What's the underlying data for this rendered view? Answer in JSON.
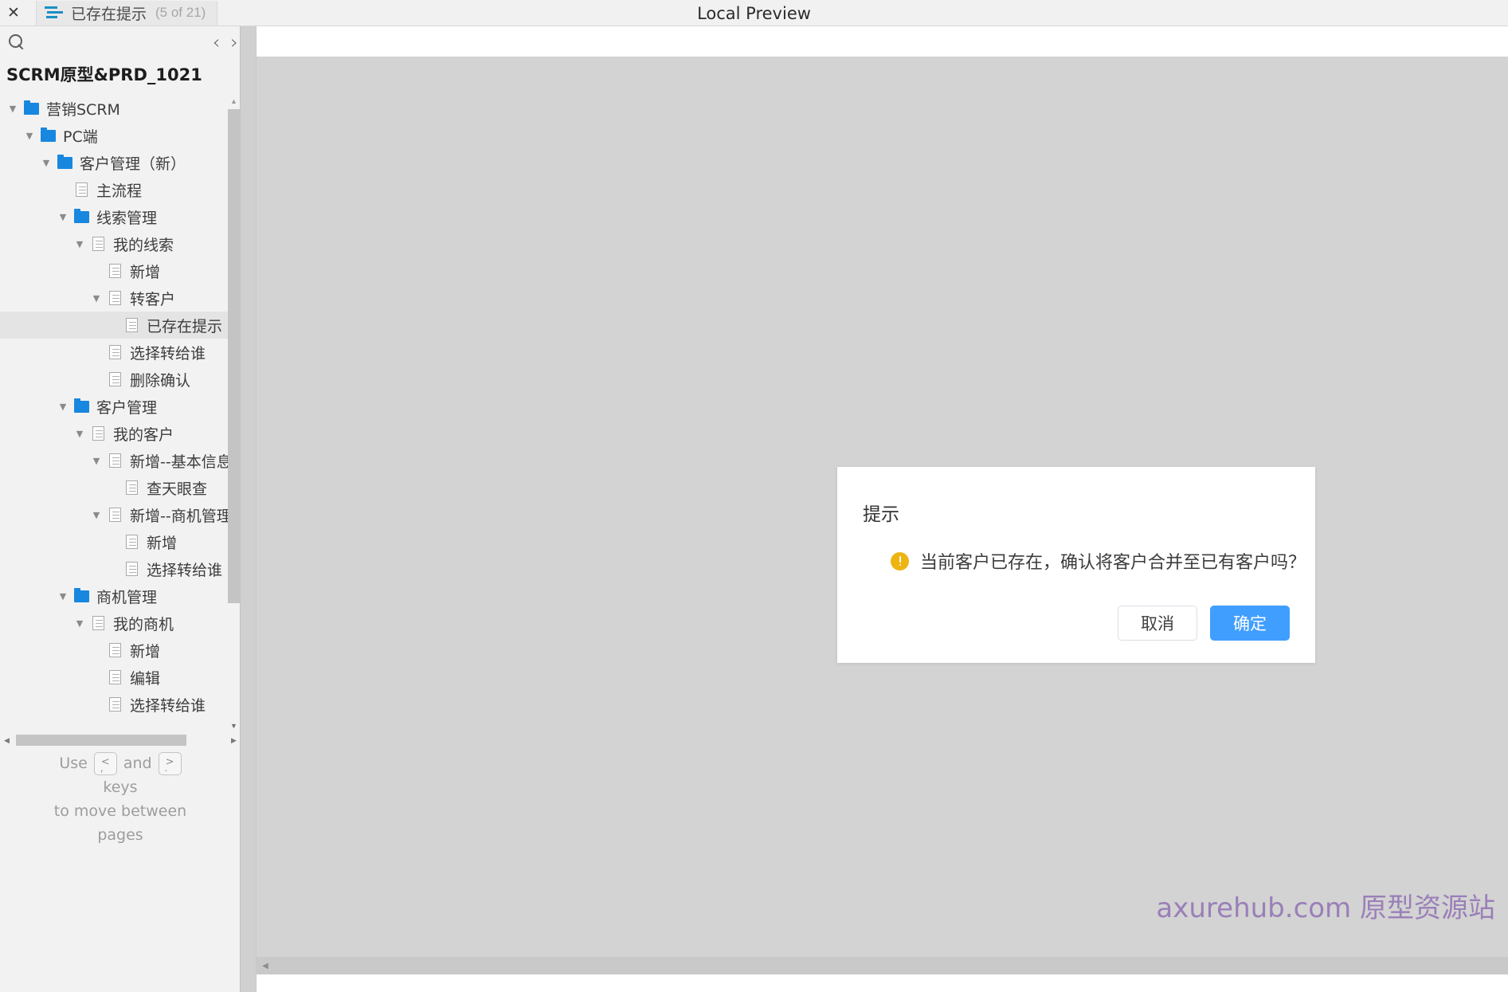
{
  "window": {
    "preview_title": "Local Preview"
  },
  "tab": {
    "close_label": "✕",
    "title": "已存在提示",
    "count": "(5 of 21)"
  },
  "panel": {
    "search_placeholder": "",
    "prev_label": "‹",
    "next_label": "›",
    "project_title": "SCRM原型&PRD_1021"
  },
  "tree": {
    "items": [
      {
        "label": "营销SCRM",
        "depth": 0,
        "icon": "folder",
        "caret": "down",
        "selected": false
      },
      {
        "label": "PC端",
        "depth": 1,
        "icon": "folder",
        "caret": "down",
        "selected": false
      },
      {
        "label": "客户管理（新）",
        "depth": 2,
        "icon": "folder",
        "caret": "down",
        "selected": false
      },
      {
        "label": "主流程",
        "depth": 3,
        "icon": "page",
        "caret": "none",
        "selected": false
      },
      {
        "label": "线索管理",
        "depth": 3,
        "icon": "folder",
        "caret": "down",
        "selected": false
      },
      {
        "label": "我的线索",
        "depth": 4,
        "icon": "page",
        "caret": "down",
        "selected": false
      },
      {
        "label": "新增",
        "depth": 5,
        "icon": "page",
        "caret": "none",
        "selected": false
      },
      {
        "label": "转客户",
        "depth": 5,
        "icon": "page",
        "caret": "down",
        "selected": false
      },
      {
        "label": "已存在提示",
        "depth": 6,
        "icon": "page",
        "caret": "none",
        "selected": true
      },
      {
        "label": "选择转给谁",
        "depth": 5,
        "icon": "page",
        "caret": "none",
        "selected": false
      },
      {
        "label": "删除确认",
        "depth": 5,
        "icon": "page",
        "caret": "none",
        "selected": false
      },
      {
        "label": "客户管理",
        "depth": 3,
        "icon": "folder",
        "caret": "down",
        "selected": false
      },
      {
        "label": "我的客户",
        "depth": 4,
        "icon": "page",
        "caret": "down",
        "selected": false
      },
      {
        "label": "新增--基本信息",
        "depth": 5,
        "icon": "page",
        "caret": "down",
        "selected": false
      },
      {
        "label": "查天眼查",
        "depth": 6,
        "icon": "page",
        "caret": "none",
        "selected": false
      },
      {
        "label": "新增--商机管理",
        "depth": 5,
        "icon": "page",
        "caret": "down",
        "selected": false
      },
      {
        "label": "新增",
        "depth": 6,
        "icon": "page",
        "caret": "none",
        "selected": false
      },
      {
        "label": "选择转给谁",
        "depth": 6,
        "icon": "page",
        "caret": "none",
        "selected": false
      },
      {
        "label": "商机管理",
        "depth": 3,
        "icon": "folder",
        "caret": "down",
        "selected": false
      },
      {
        "label": "我的商机",
        "depth": 4,
        "icon": "page",
        "caret": "down",
        "selected": false
      },
      {
        "label": "新增",
        "depth": 5,
        "icon": "page",
        "caret": "none",
        "selected": false
      },
      {
        "label": "编辑",
        "depth": 5,
        "icon": "page",
        "caret": "none",
        "selected": false
      },
      {
        "label": "选择转给谁",
        "depth": 5,
        "icon": "page",
        "caret": "none",
        "selected": false
      }
    ]
  },
  "hint": {
    "use": "Use",
    "key_prev": "<",
    "key_prev_sub": ",",
    "and": "and",
    "key_next": ">",
    "key_next_sub": ".",
    "keys": "keys",
    "line2": "to move between",
    "line3": "pages"
  },
  "dialog": {
    "title": "提示",
    "message": "当前客户已存在，确认将客户合并至已有客户吗？",
    "cancel_label": "取消",
    "confirm_label": "确定",
    "warn_color": "#eeb411"
  },
  "watermark": {
    "text": "axurehub.com 原型资源站",
    "color": "#9a7fb8"
  }
}
